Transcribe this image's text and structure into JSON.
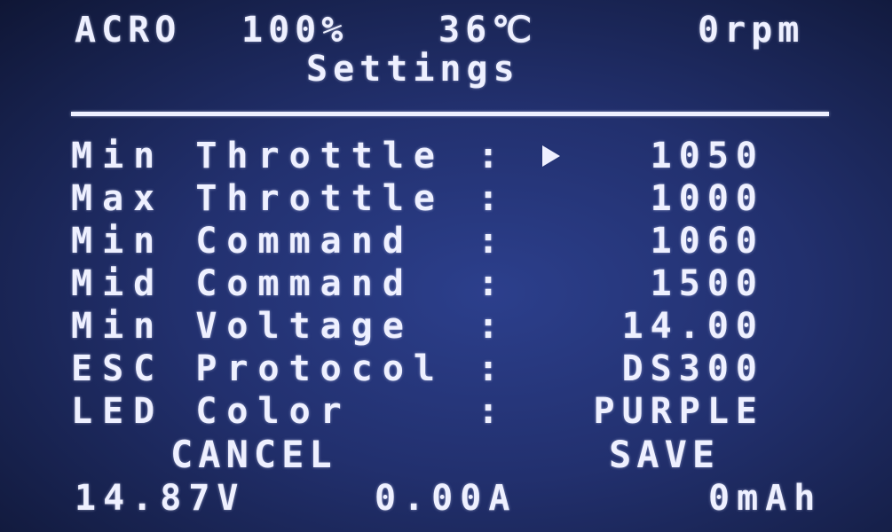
{
  "status_bar": {
    "mode": "ACRO",
    "throttle": "100%",
    "temperature": "36℃",
    "rpm": "0rpm"
  },
  "title": "Settings",
  "settings": [
    {
      "label": "Min Throttle",
      "colon": ":",
      "value": "1050",
      "selected": true
    },
    {
      "label": "Max Throttle",
      "colon": ":",
      "value": "1000",
      "selected": false
    },
    {
      "label": "Min Command",
      "colon": ":",
      "value": "1060",
      "selected": false
    },
    {
      "label": "Mid Command",
      "colon": ":",
      "value": "1500",
      "selected": false
    },
    {
      "label": "Min Voltage",
      "colon": ":",
      "value": "14.00",
      "selected": false
    },
    {
      "label": "ESC Protocol",
      "colon": ":",
      "value": "DS300",
      "selected": false
    },
    {
      "label": "LED Color",
      "colon": ":",
      "value": "PURPLE",
      "selected": false
    }
  ],
  "buttons": {
    "cancel": "CANCEL",
    "save": "SAVE"
  },
  "footer": {
    "voltage": "14.87V",
    "current": "0.00A",
    "capacity": "0mAh"
  },
  "colors": {
    "text": "#eef0ff",
    "background": "#22306e"
  },
  "icons": {
    "cursor": "play-arrow-icon"
  }
}
